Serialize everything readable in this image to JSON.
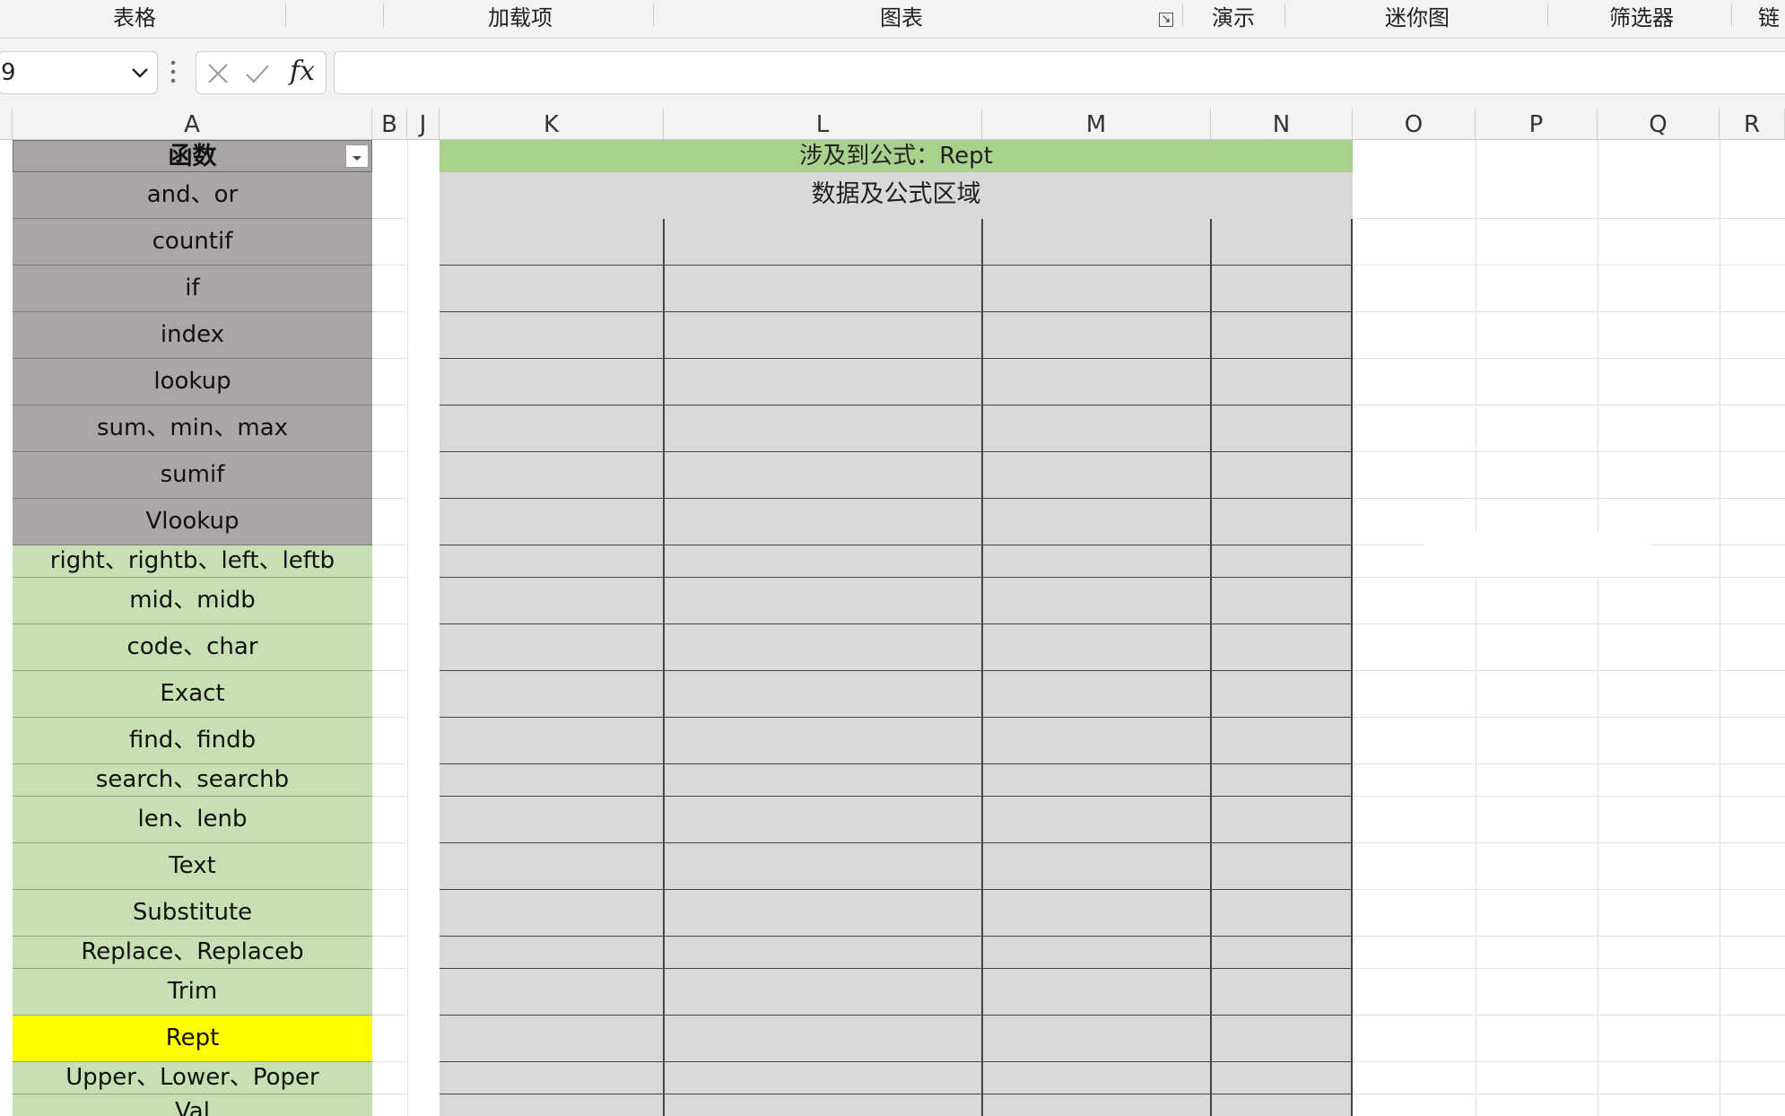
{
  "ribbon": {
    "groups": [
      "表格",
      "加载项",
      "图表",
      "演示",
      "迷你图",
      "筛选器",
      "链"
    ]
  },
  "formula_bar": {
    "name_box_value": "9",
    "formula_value": ""
  },
  "column_headers": [
    "A",
    "B",
    "J",
    "K",
    "L",
    "M",
    "N",
    "O",
    "P",
    "Q",
    "R"
  ],
  "column_a": {
    "header": "函数",
    "items": [
      "and、or",
      "countif",
      "if",
      "index",
      "lookup",
      "sum、min、max",
      "sumif",
      "Vlookup",
      "right、rightb、left、leftb",
      "mid、midb",
      "code、char",
      "Exact",
      "find、findb",
      "search、searchb",
      "len、lenb",
      "Text",
      "Substitute",
      "Replace、Replaceb",
      "Trim",
      "Rept",
      "Upper、Lower、Poper",
      "Val"
    ],
    "highlighted_item": "Rept"
  },
  "data_region": {
    "title": "涉及到公式：Rept",
    "subtitle": "数据及公式区域"
  },
  "colors": {
    "gray_rows": "#aaa6a6",
    "green_rows": "#c6e0b4",
    "highlight": "#ffff00",
    "title_bar": "#a9d18e",
    "data_region": "#d9d9d9"
  }
}
